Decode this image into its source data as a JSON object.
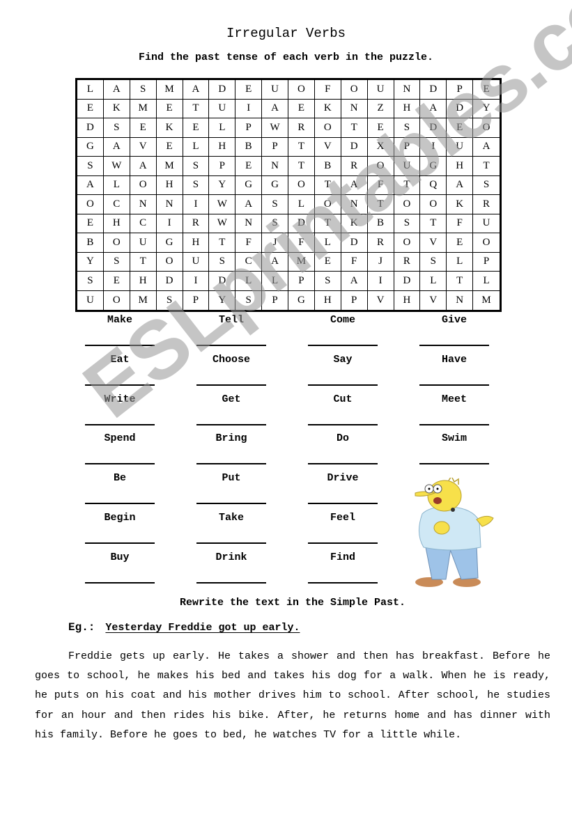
{
  "title": "Irregular Verbs",
  "subtitle": "Find the past tense of each verb in the puzzle.",
  "puzzle": {
    "rows": [
      [
        "L",
        "A",
        "S",
        "M",
        "A",
        "D",
        "E",
        "U",
        "O",
        "F",
        "O",
        "U",
        "N",
        "D",
        "P",
        "E"
      ],
      [
        "E",
        "K",
        "M",
        "E",
        "T",
        "U",
        "I",
        "A",
        "E",
        "K",
        "N",
        "Z",
        "H",
        "A",
        "D",
        "Y"
      ],
      [
        "D",
        "S",
        "E",
        "K",
        "E",
        "L",
        "P",
        "W",
        "R",
        "O",
        "T",
        "E",
        "S",
        "D",
        "E",
        "O"
      ],
      [
        "G",
        "A",
        "V",
        "E",
        "L",
        "H",
        "B",
        "P",
        "T",
        "V",
        "D",
        "X",
        "P",
        "I",
        "U",
        "A"
      ],
      [
        "S",
        "W",
        "A",
        "M",
        "S",
        "P",
        "E",
        "N",
        "T",
        "B",
        "R",
        "O",
        "U",
        "G",
        "H",
        "T"
      ],
      [
        "A",
        "L",
        "O",
        "H",
        "S",
        "Y",
        "G",
        "G",
        "O",
        "T",
        "A",
        "F",
        "T",
        "Q",
        "A",
        "S"
      ],
      [
        "O",
        "C",
        "N",
        "N",
        "I",
        "W",
        "A",
        "S",
        "L",
        "O",
        "N",
        "T",
        "O",
        "O",
        "K",
        "R"
      ],
      [
        "E",
        "H",
        "C",
        "I",
        "R",
        "W",
        "N",
        "S",
        "D",
        "T",
        "K",
        "B",
        "S",
        "T",
        "F",
        "U"
      ],
      [
        "B",
        "O",
        "U",
        "G",
        "H",
        "T",
        "F",
        "J",
        "F",
        "L",
        "D",
        "R",
        "O",
        "V",
        "E",
        "O"
      ],
      [
        "Y",
        "S",
        "T",
        "O",
        "U",
        "S",
        "C",
        "A",
        "M",
        "E",
        "F",
        "J",
        "R",
        "S",
        "L",
        "P"
      ],
      [
        "S",
        "E",
        "H",
        "D",
        "I",
        "D",
        "L",
        "L",
        "P",
        "S",
        "A",
        "I",
        "D",
        "L",
        "T",
        "L"
      ],
      [
        "U",
        "O",
        "M",
        "S",
        "P",
        "Y",
        "S",
        "P",
        "G",
        "H",
        "P",
        "V",
        "H",
        "V",
        "N",
        "M"
      ]
    ]
  },
  "verbs": [
    [
      "Make",
      "Tell",
      "Come",
      "Give"
    ],
    [
      "Eat",
      "Choose",
      "Say",
      "Have"
    ],
    [
      "Write",
      "Get",
      "Cut",
      "Meet"
    ],
    [
      "Spend",
      "Bring",
      "Do",
      "Swim"
    ],
    [
      "Be",
      "Put",
      "Drive"
    ],
    [
      "Begin",
      "Take",
      "Feel"
    ],
    [
      "Buy",
      "Drink",
      "Find"
    ]
  ],
  "cartoon": {
    "icon": "grandpa-cartoon-icon",
    "colors": {
      "skin": "#f7e04a",
      "shirt": "#cfe8f5",
      "pants": "#9ec3e8",
      "shoes": "#c98b58"
    }
  },
  "instruction": "Rewrite the text in the Simple Past.",
  "example": {
    "label": "Eg.:",
    "text": "Yesterday Freddie got up early."
  },
  "paragraph": "Freddie gets up early. He takes a shower and then has breakfast. Before he goes to school, he makes his bed and takes his dog for a walk. When he is ready, he puts on his coat and his mother drives him to school. After school, he studies for an hour and then rides his bike. After, he returns home and has dinner with his family. Before he goes to bed, he watches TV for a little while.",
  "watermark": "ESLprintables.com"
}
